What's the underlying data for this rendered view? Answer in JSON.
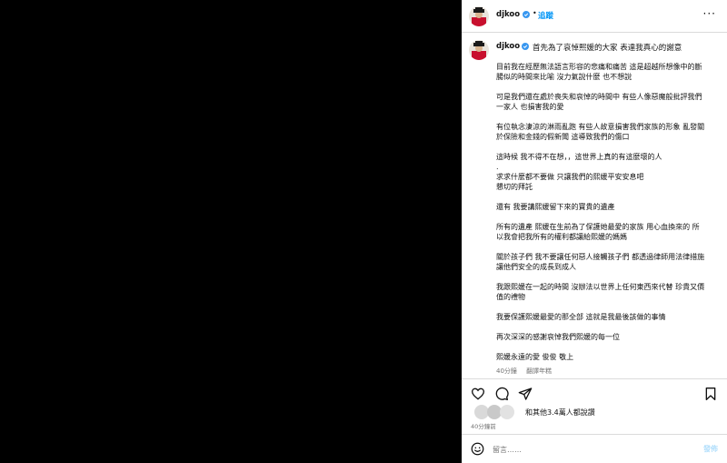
{
  "header": {
    "username": "djkoo",
    "separator": "•",
    "follow_label": "追蹤",
    "more_label": "···"
  },
  "caption": {
    "username": "djkoo",
    "first_line": "首先為了哀悼熙媛的大家 表達我真心的謝意",
    "lines": [
      "目前我在經歷無法語言形容的悲痛和痛苦 這是超越所想像中的斷",
      "腸似的時間來比喻 沒力氣說什麼 也不想說",
      "",
      "可是我們還在處於喪失和哀悼的時間中 有些人像惡魔般批評我們",
      "一家人 也損害我的愛",
      "",
      "有位執念淒涼的淋雨亂跑 有些人故意損害我們家族的形象 亂發關",
      "於保險和金錢的假新聞 這導致我們的傷口",
      "",
      "這時候 我不得不在想，，這世界上真的有這麼壞的人",
      ".",
      "求求什麼都不要做 只讓我們的熙媛平安安息吧",
      "懇切的拜託",
      "",
      "還有 我要講熙媛留下來的寶貴的遺產",
      "",
      "所有的遺產 熙媛在生前為了保護她最愛的家族 用心血換來的 所",
      "以我會把我所有的權利都讓給熙媛的媽媽",
      "",
      "關於孩子們 我不要讓任何惡人接觸孩子們 都透過律師用法律措施",
      "讓他們安全的成長到成人",
      "",
      "我跟熙媛在一起的時間 沒辦法以世界上任何東西來代替 珍貴又價",
      "值的禮物",
      "",
      "我要保護熙媛最愛的那全部 這就是我最後該做的事情",
      "",
      "再次深深的感謝哀悼我們熙媛的每一位",
      "",
      "熙媛永遠的愛 俊俊 敬上"
    ],
    "meta_time": "40分鐘",
    "meta_translate": "翻譯年糕"
  },
  "actions": {
    "like_icon": "heart-icon",
    "comment_icon": "comment-icon",
    "share_icon": "share-icon",
    "save_icon": "bookmark-icon"
  },
  "likes": {
    "text": "和其他3.4萬人都說讚"
  },
  "time_ago": "40分鐘前",
  "comment": {
    "placeholder": "留言……",
    "post_label": "發佈"
  },
  "colors": {
    "accent": "#0095f6",
    "verified": "#3897f0",
    "avatar_red": "#c8102e"
  }
}
